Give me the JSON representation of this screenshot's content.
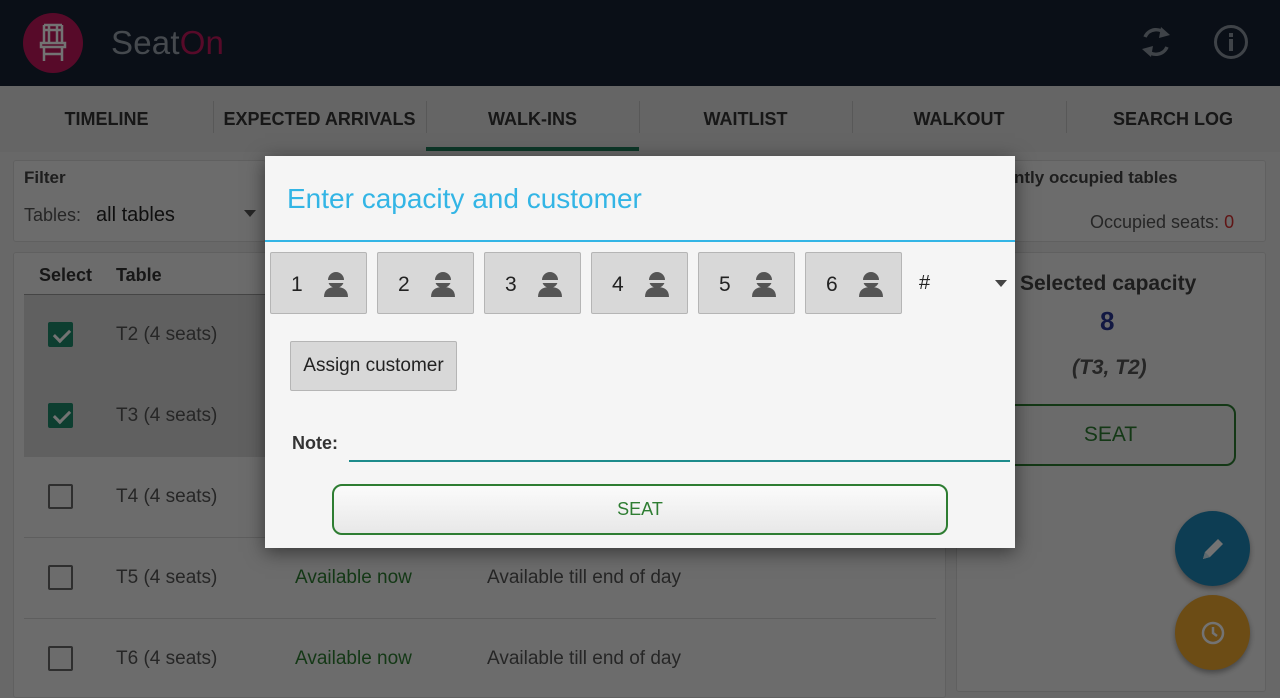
{
  "app": {
    "title_part1": "Seat",
    "title_part2": "On"
  },
  "header": {
    "sync_icon": "sync-icon",
    "info_icon": "info-icon"
  },
  "tabs": [
    {
      "label": "TIMELINE"
    },
    {
      "label": "EXPECTED ARRIVALS"
    },
    {
      "label": "WALK-INS",
      "active": true
    },
    {
      "label": "WAITLIST"
    },
    {
      "label": "WALKOUT"
    },
    {
      "label": "SEARCH LOG"
    }
  ],
  "filter": {
    "title": "Filter",
    "tables_label": "Tables:",
    "tables_value": "all tables"
  },
  "table_list": {
    "headers": {
      "select": "Select",
      "table": "Table"
    },
    "rows": [
      {
        "name": "T2 (4 seats)",
        "checked": true,
        "availability": "",
        "until": ""
      },
      {
        "name": "T3 (4 seats)",
        "checked": true,
        "availability": "",
        "until": ""
      },
      {
        "name": "T4 (4 seats)",
        "checked": false,
        "availability": "",
        "until": ""
      },
      {
        "name": "T5 (4 seats)",
        "checked": false,
        "availability": "Available now",
        "until": "Available till end of day"
      },
      {
        "name": "T6 (4 seats)",
        "checked": false,
        "availability": "Available now",
        "until": "Available till end of day"
      }
    ]
  },
  "occupied": {
    "title": "ntly occupied tables",
    "seats_label": "Occupied seats:",
    "seats_value": "0"
  },
  "selected_capacity": {
    "title": "Selected capacity",
    "value": "8",
    "tables": "(T3, T2)",
    "seat_label": "SEAT"
  },
  "dialog": {
    "title": "Enter capacity and customer",
    "capacities": [
      "1",
      "2",
      "3",
      "4",
      "5",
      "6"
    ],
    "other_capacity": "#",
    "assign_label": "Assign customer",
    "note_label": "Note:",
    "note_value": "",
    "seat_label": "SEAT"
  },
  "colors": {
    "header_bg": "#172233",
    "brand": "#c2185b",
    "dialog_accent": "#33b5e5",
    "seat_green": "#2e7d32",
    "fab_edit": "#1e88b8",
    "fab_clock": "#f0a830"
  },
  "fabs": {
    "edit_icon": "pencil-icon",
    "clock_icon": "clock-icon"
  }
}
